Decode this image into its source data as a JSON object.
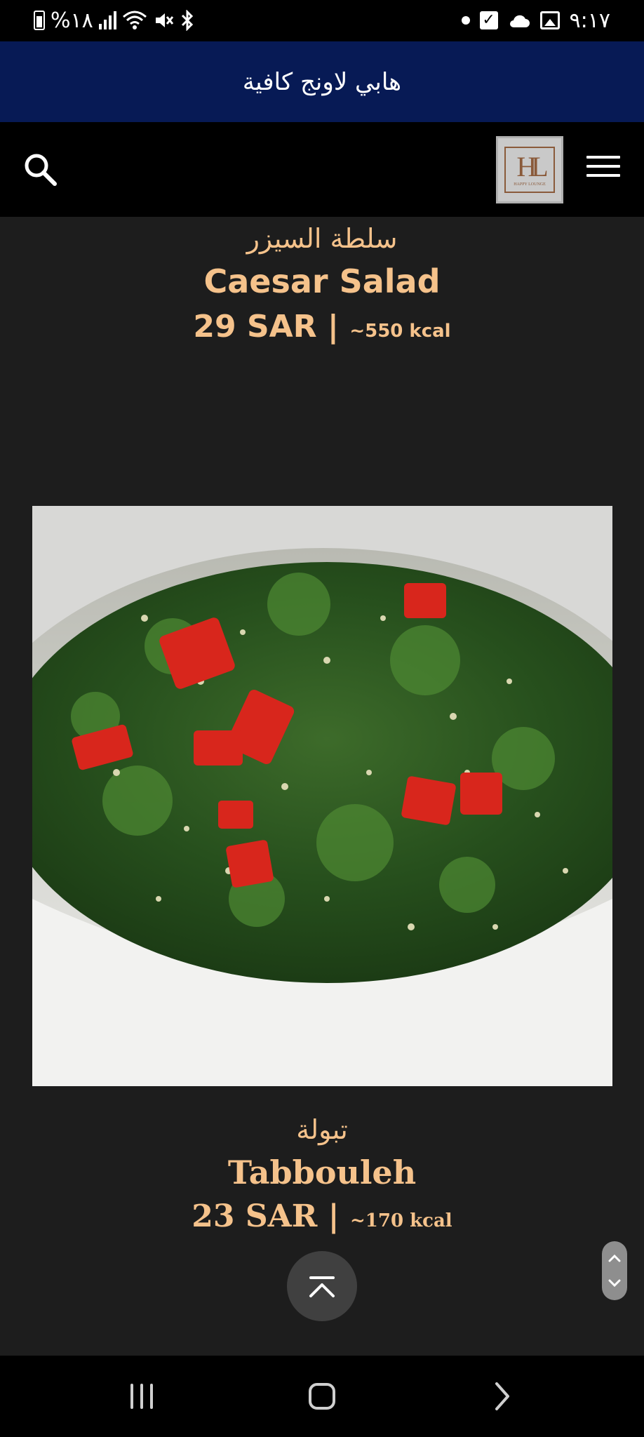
{
  "status_bar": {
    "battery_percent": "%١٨",
    "time": "٩:١٧",
    "icons": [
      "battery-icon",
      "signal-icon",
      "wifi-icon",
      "mute-icon",
      "bluetooth-icon",
      "dot-icon",
      "checkbox-notification-icon",
      "cloud-icon",
      "image-icon"
    ]
  },
  "banner": {
    "title": "هابي لاونج كافية"
  },
  "header": {
    "icons": [
      "search-icon",
      "logo",
      "menu-icon"
    ],
    "logo_text": "HAPPY LOUNGE"
  },
  "items": [
    {
      "name_ar": "سلطة السيزر",
      "name_en": "Caesar Salad",
      "price": "29 SAR",
      "separator": "|",
      "kcal": "~550 kcal"
    },
    {
      "name_ar": "تبولة",
      "name_en": "Tabbouleh",
      "price": "23 SAR",
      "separator": "|",
      "kcal": "~170 kcal"
    }
  ],
  "colors": {
    "banner_bg": "#071a55",
    "page_bg": "#1d1d1d",
    "accent_text": "#f5c28b"
  },
  "nav_bar": {
    "buttons": [
      "recent-apps-button",
      "home-button",
      "back-button"
    ]
  }
}
